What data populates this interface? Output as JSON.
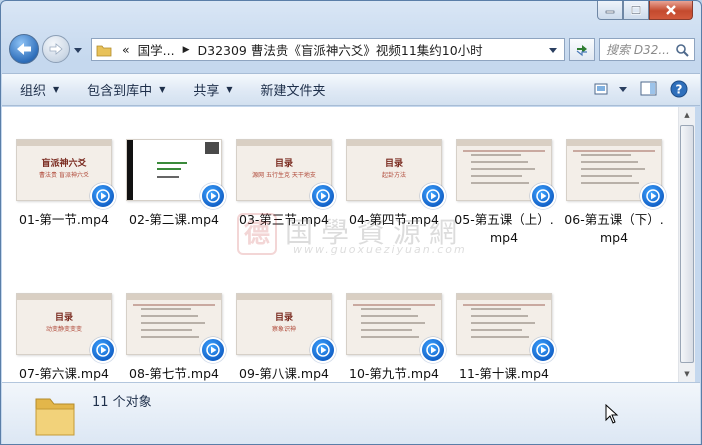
{
  "address": {
    "segments": [
      "国学...",
      "D32309 曹法贵《盲派神六爻》视频11集约10小时"
    ],
    "breadcrumb_lead": "«"
  },
  "search": {
    "placeholder": "搜索 D32..."
  },
  "toolbar": {
    "organize": "组织",
    "include_library": "包含到库中",
    "share": "共享",
    "new_folder": "新建文件夹"
  },
  "files": [
    {
      "name": "01-第一节.mp4",
      "thumb_title": "盲派神六爻",
      "thumb_sub": "曹法贵 盲派神六爻"
    },
    {
      "name": "02-第二课.mp4",
      "thumb_title": "",
      "thumb_sub": ""
    },
    {
      "name": "03-第三节.mp4",
      "thumb_title": "目录",
      "thumb_sub": "源网 五行生克 天干地支"
    },
    {
      "name": "04-第四节.mp4",
      "thumb_title": "目录",
      "thumb_sub": "起卦方法"
    },
    {
      "name": "05-第五课（上）.mp4",
      "thumb_title": "",
      "thumb_sub": ""
    },
    {
      "name": "06-第五课（下）.mp4",
      "thumb_title": "",
      "thumb_sub": ""
    },
    {
      "name": "07-第六课.mp4",
      "thumb_title": "目录",
      "thumb_sub": "动变静变变变"
    },
    {
      "name": "08-第七节.mp4",
      "thumb_title": "",
      "thumb_sub": ""
    },
    {
      "name": "09-第八课.mp4",
      "thumb_title": "目录",
      "thumb_sub": "察象识神"
    },
    {
      "name": "10-第九节.mp4",
      "thumb_title": "",
      "thumb_sub": ""
    },
    {
      "name": "11-第十课.mp4",
      "thumb_title": "",
      "thumb_sub": ""
    }
  ],
  "watermark": {
    "glyph": "德",
    "text": "国學資源網",
    "url": "www.guoxueziyuan.com"
  },
  "status": {
    "count": "11 个对象"
  },
  "colors": {
    "play_button": "#1463c9",
    "accent_red": "#c02020"
  }
}
